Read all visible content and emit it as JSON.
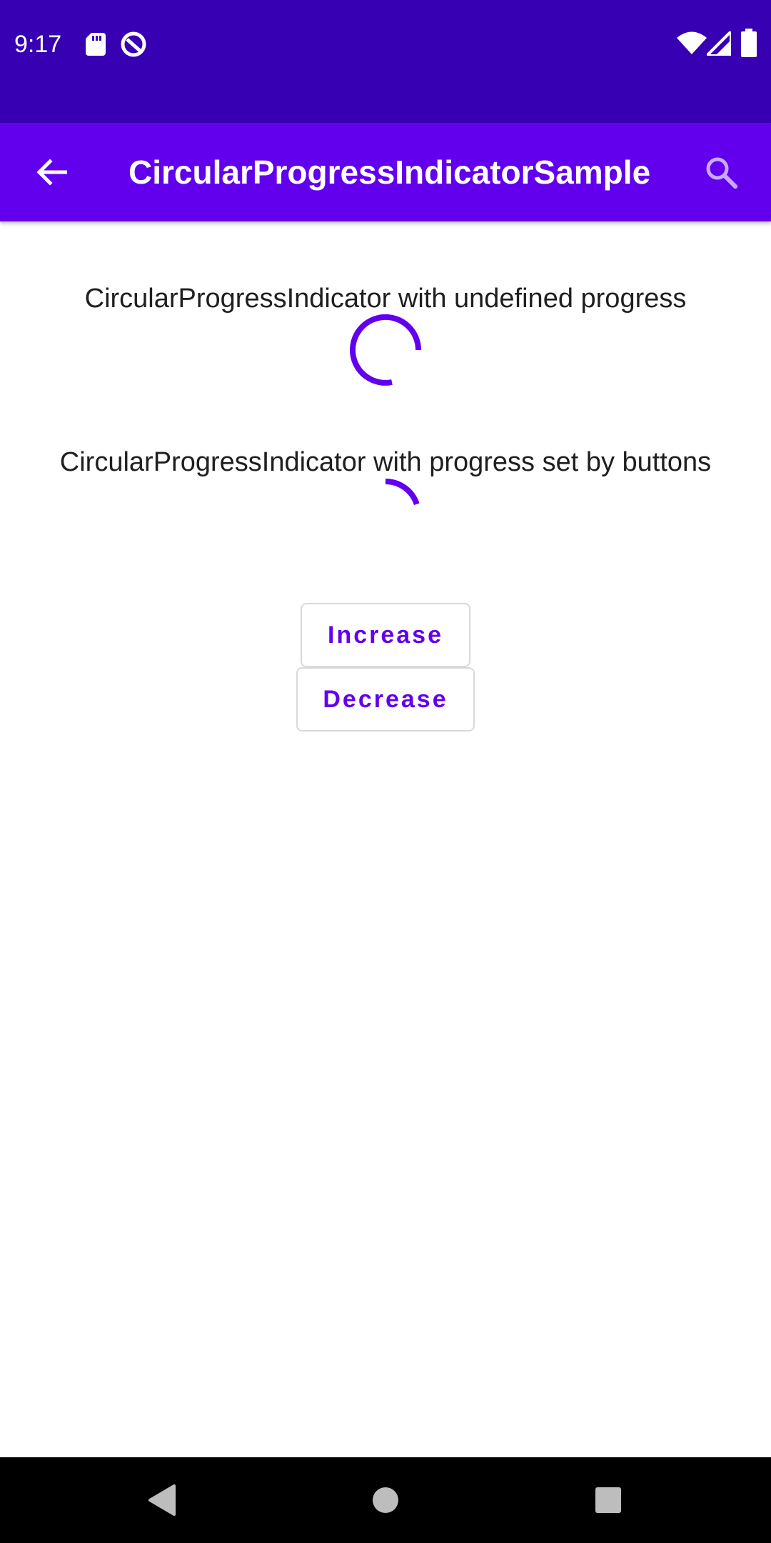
{
  "status_bar": {
    "time": "9:17",
    "left_icons": [
      "sd-card-icon",
      "data-saver-icon"
    ],
    "right_icons": [
      "wifi-icon",
      "cellular-signal-icon",
      "battery-icon"
    ]
  },
  "app_bar": {
    "title": "CircularProgressIndicatorSample",
    "back_icon": "arrow-back-icon",
    "search_icon": "search-icon"
  },
  "sections": {
    "indeterminate_label": "CircularProgressIndicator with undefined progress",
    "determinate_label": "CircularProgressIndicator with progress set by buttons",
    "determinate_progress": 0.2
  },
  "buttons": {
    "increase_label": "Increase",
    "decrease_label": "Decrease"
  },
  "nav_bar": {
    "icons": [
      "nav-back-icon",
      "nav-home-icon",
      "nav-recents-icon"
    ]
  },
  "colors": {
    "status_bar": "#3700b3",
    "primary": "#6200ee",
    "text": "#1f1f1f",
    "button_border": "#d9d9d9",
    "nav_bar": "#000000"
  }
}
